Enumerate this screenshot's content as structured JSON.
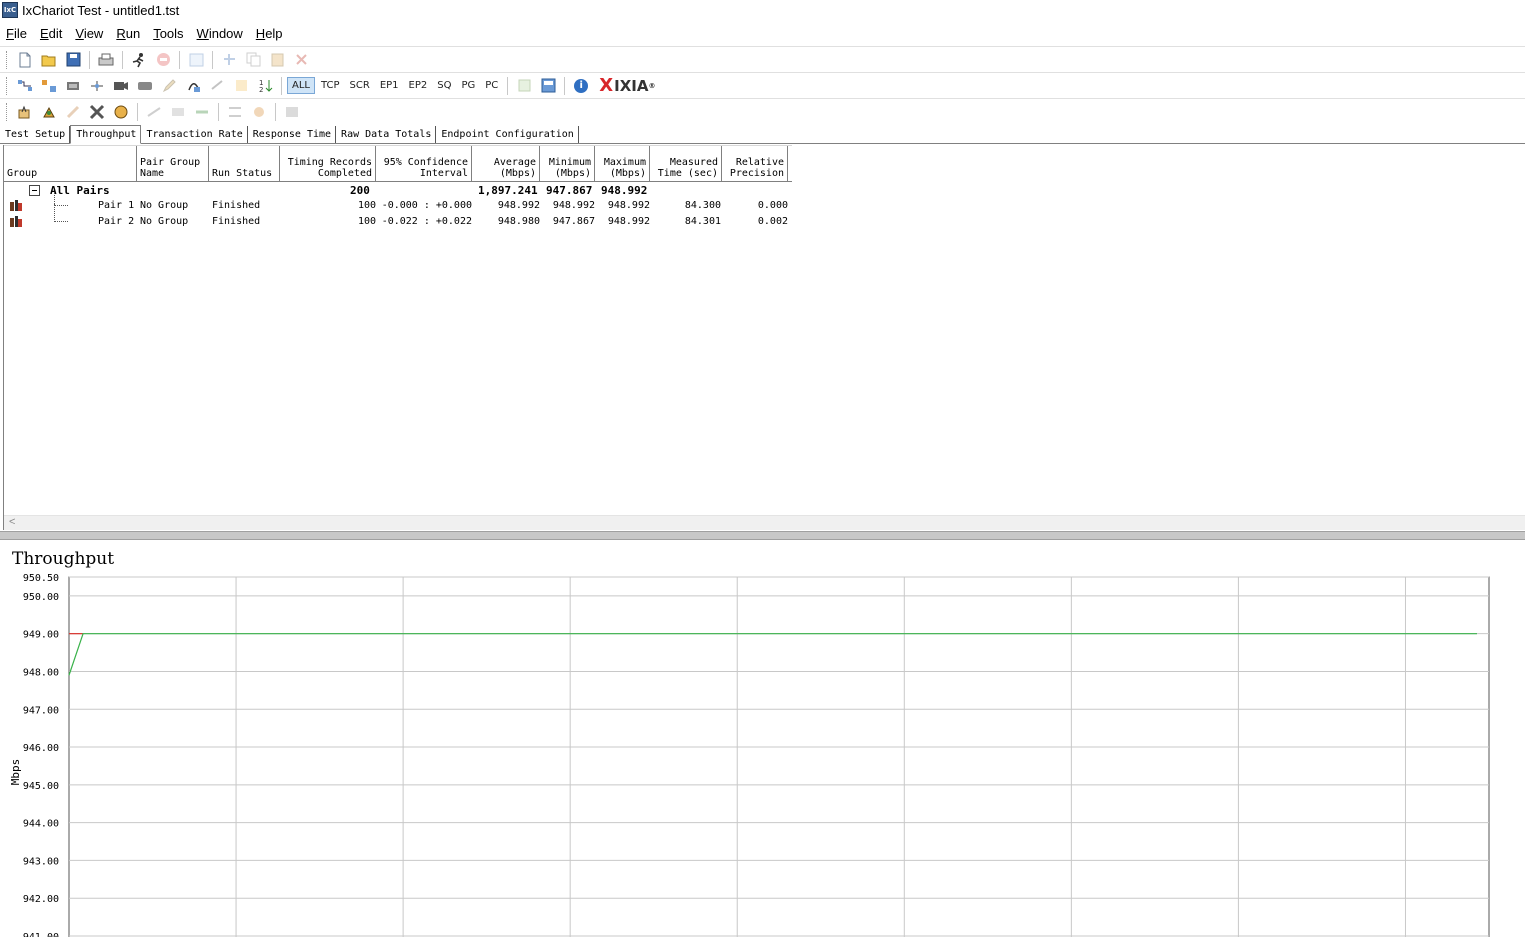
{
  "window": {
    "title": "IxChariot Test - untitled1.tst",
    "icon_text": "IxC"
  },
  "menu": [
    "File",
    "Edit",
    "View",
    "Run",
    "Tools",
    "Window",
    "Help"
  ],
  "menu_mnemonics": [
    "F",
    "E",
    "V",
    "R",
    "T",
    "W",
    "H"
  ],
  "toolbar_filters": [
    "ALL",
    "TCP",
    "SCR",
    "EP1",
    "EP2",
    "SQ",
    "PG",
    "PC"
  ],
  "toolbar_active_filter": "ALL",
  "brand": {
    "x": "X",
    "name": "IXIA",
    "mark": "®"
  },
  "tabs": [
    "Test Setup",
    "Throughput",
    "Transaction Rate",
    "Response Time",
    "Raw Data Totals",
    "Endpoint Configuration"
  ],
  "active_tab": "Throughput",
  "columns": [
    {
      "l1": "",
      "l2": "Group"
    },
    {
      "l1": "Pair Group",
      "l2": "Name"
    },
    {
      "l1": "",
      "l2": "Run Status"
    },
    {
      "l1": "Timing Records",
      "l2": "Completed"
    },
    {
      "l1": "95% Confidence",
      "l2": "Interval"
    },
    {
      "l1": "Average",
      "l2": "(Mbps)"
    },
    {
      "l1": "Minimum",
      "l2": "(Mbps)"
    },
    {
      "l1": "Maximum",
      "l2": "(Mbps)"
    },
    {
      "l1": "Measured",
      "l2": "Time (sec)"
    },
    {
      "l1": "Relative",
      "l2": "Precision"
    }
  ],
  "summary": {
    "label": "All Pairs",
    "records": "200",
    "average": "1,897.241",
    "minimum": "947.867",
    "maximum": "948.992"
  },
  "pairs": [
    {
      "pair": "Pair 1",
      "group": "No Group",
      "status": "Finished",
      "records": "100",
      "interval": "-0.000 : +0.000",
      "average": "948.992",
      "minimum": "948.992",
      "maximum": "948.992",
      "time": "84.300",
      "precision": "0.000"
    },
    {
      "pair": "Pair 2",
      "group": "No Group",
      "status": "Finished",
      "records": "100",
      "interval": "-0.022 : +0.022",
      "average": "948.980",
      "minimum": "947.867",
      "maximum": "948.992",
      "time": "84.301",
      "precision": "0.002"
    }
  ],
  "scroll_arrow": "<",
  "chart_data": {
    "type": "line",
    "title": "Throughput",
    "ylabel": "Mbps",
    "xlabel": "",
    "ylim": [
      941.0,
      950.5
    ],
    "y_ticks": [
      "950.50",
      "950.00",
      "949.00",
      "948.00",
      "947.00",
      "946.00",
      "945.00",
      "944.00",
      "943.00",
      "942.00",
      "941.00"
    ],
    "y_tick_values": [
      950.5,
      950.0,
      949.0,
      948.0,
      947.0,
      946.0,
      945.0,
      944.0,
      943.0,
      942.0,
      941.0
    ],
    "x_gridlines": 9,
    "grid": true,
    "series": [
      {
        "color": "#d9302a",
        "points": [
          [
            0,
            949.0
          ],
          [
            1,
            949.0
          ]
        ]
      },
      {
        "color": "#39b24a",
        "points": [
          [
            0,
            947.9
          ],
          [
            1,
            949.0
          ],
          [
            100,
            949.0
          ]
        ]
      }
    ],
    "x_range": [
      0,
      100
    ]
  }
}
